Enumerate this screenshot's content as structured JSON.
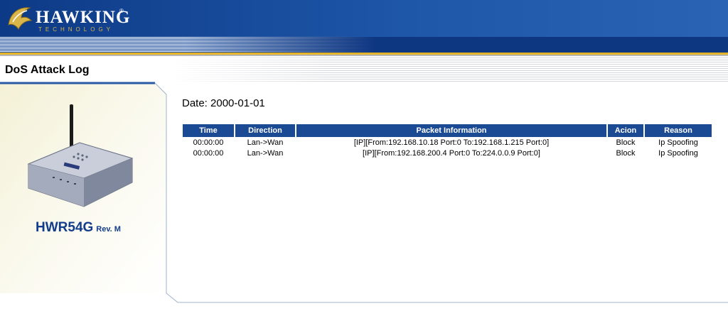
{
  "header": {
    "brand": "HAWKING",
    "brand_sub": "TECHNOLOGY",
    "registered_mark": "®",
    "colors": {
      "navy": "#0d3a86",
      "gold": "#e5b42a"
    }
  },
  "page_title": "DoS Attack Log",
  "product": {
    "model": "HWR54G",
    "revision": "Rev. M"
  },
  "log": {
    "date_text": "Date: 2000-01-01",
    "columns": [
      "Time",
      "Direction",
      "Packet Information",
      "Acion",
      "Reason"
    ],
    "rows": [
      {
        "time": "00:00:00",
        "direction": "Lan->Wan",
        "packet": "[IP][From:192.168.10.18 Port:0 To:192.168.1.215 Port:0]",
        "action": "Block",
        "reason": "Ip Spoofing"
      },
      {
        "time": "00:00:00",
        "direction": "Lan->Wan",
        "packet": "[IP][From:192.168.200.4 Port:0 To:224.0.0.9 Port:0]",
        "action": "Block",
        "reason": "Ip Spoofing"
      }
    ]
  }
}
